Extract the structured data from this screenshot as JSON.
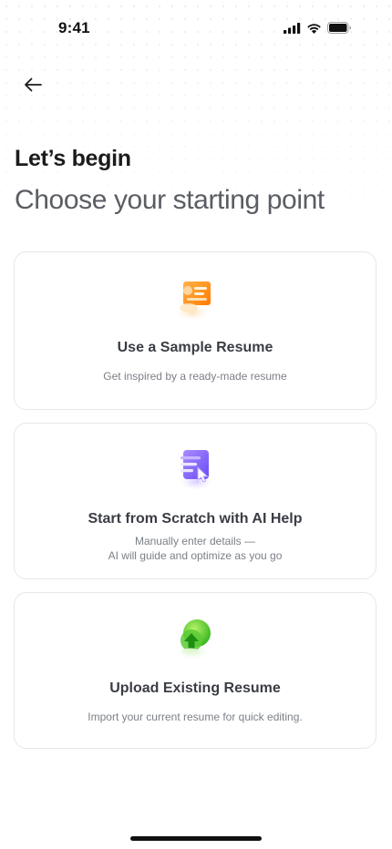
{
  "status_bar": {
    "time": "9:41",
    "icons": [
      "cellular-signal-icon",
      "wifi-icon",
      "battery-icon"
    ]
  },
  "header": {
    "back_icon": "arrow-left-icon",
    "title": "Let’s begin",
    "subtitle": "Choose your starting point"
  },
  "options": [
    {
      "icon": "sample-resume-icon",
      "title": "Use a Sample Resume",
      "description_lines": [
        "Get inspired by a ready-made resume"
      ],
      "accent": "#FF8A00"
    },
    {
      "icon": "ai-scratch-icon",
      "title": "Start from Scratch with AI Help",
      "description_lines": [
        "Manually enter details —",
        "AI will guide and optimize as you go"
      ],
      "accent": "#7B5CFF"
    },
    {
      "icon": "upload-resume-icon",
      "title": "Upload Existing Resume",
      "description_lines": [
        "Import your current resume for quick editing."
      ],
      "accent": "#3DBE1E"
    }
  ],
  "colors": {
    "background": "#FFFFFF",
    "card_border": "#E5E7EB",
    "title_text": "#1C1C1E",
    "subtitle_text": "#5A5D63",
    "muted_text": "#7B7F86"
  }
}
